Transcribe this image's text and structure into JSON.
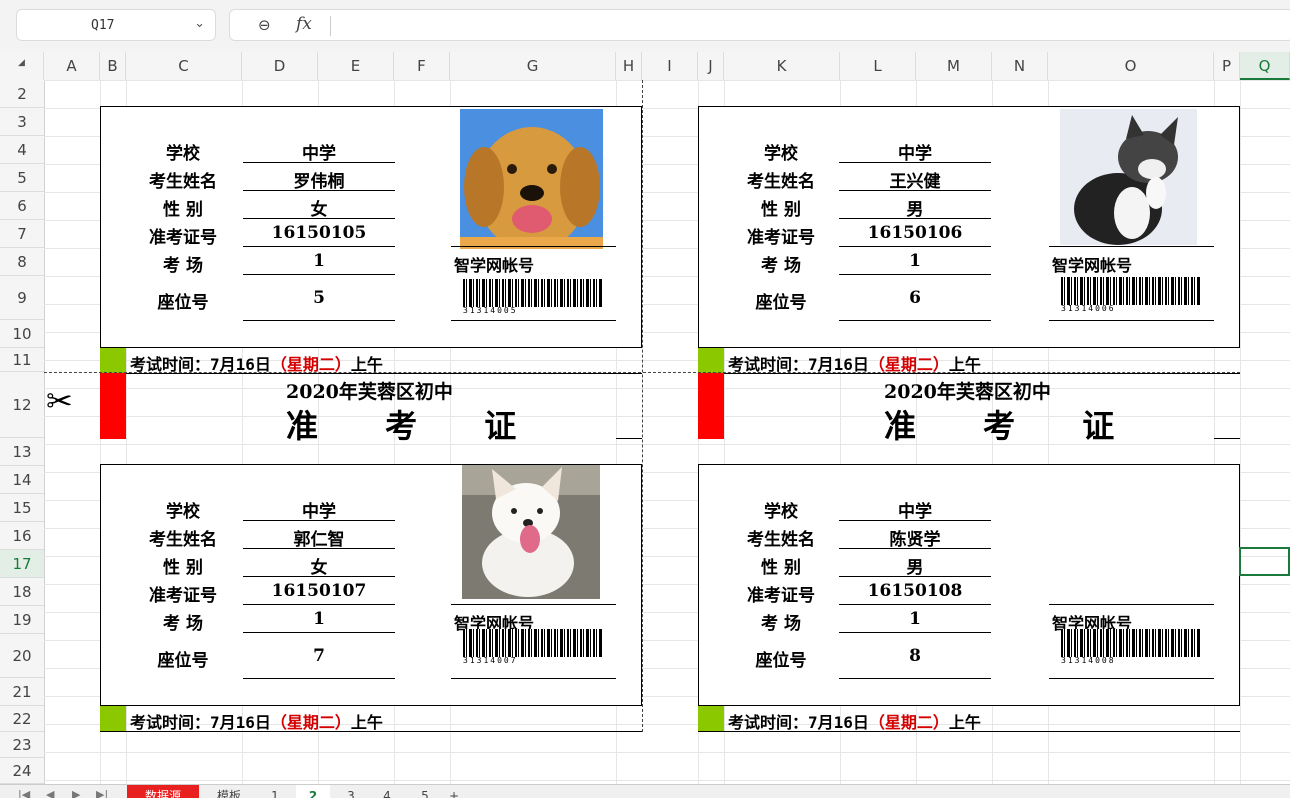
{
  "formula_bar": {
    "cell_ref": "Q17",
    "fx_label": "fx"
  },
  "columns": [
    "A",
    "B",
    "C",
    "D",
    "E",
    "F",
    "G",
    "H",
    "I",
    "J",
    "K",
    "L",
    "M",
    "N",
    "O",
    "P",
    "Q"
  ],
  "selected_column": "Q",
  "rows": [
    "2",
    "3",
    "4",
    "5",
    "6",
    "7",
    "8",
    "9",
    "10",
    "11",
    "12",
    "13",
    "14",
    "15",
    "16",
    "17",
    "18",
    "19",
    "20",
    "21",
    "22",
    "23",
    "24"
  ],
  "selected_row": "17",
  "labels": {
    "school": "学校",
    "name": "考生姓名",
    "gender": "性  别",
    "exam_no": "准考证号",
    "room": "考  场",
    "seat": "座位号",
    "account": "智学网帐号"
  },
  "title": {
    "line1": "2020年芙蓉区初中",
    "line2": "准 考 证"
  },
  "exam_time": {
    "prefix": "考试时间：7月16日",
    "weekday": "（星期二）",
    "suffix": "上午"
  },
  "cards": [
    {
      "school": "中学",
      "name": "罗伟桐",
      "gender": "女",
      "exam_no": "16150105",
      "room": "1",
      "seat": "5",
      "barcode": "31314005",
      "photo": "golden-retriever"
    },
    {
      "school": "中学",
      "name": "王兴健",
      "gender": "男",
      "exam_no": "16150106",
      "room": "1",
      "seat": "6",
      "barcode": "31314006",
      "photo": "kitten"
    },
    {
      "school": "中学",
      "name": "郭仁智",
      "gender": "女",
      "exam_no": "16150107",
      "room": "1",
      "seat": "7",
      "barcode": "31314007",
      "photo": "white-puppy"
    },
    {
      "school": "中学",
      "name": "陈贤学",
      "gender": "男",
      "exam_no": "16150108",
      "room": "1",
      "seat": "8",
      "barcode": "31314008",
      "photo": ""
    }
  ],
  "sheet_tabs": [
    "数据源",
    "模板",
    "1",
    "2",
    "3",
    "4",
    "5",
    "+"
  ],
  "active_tab": "2"
}
